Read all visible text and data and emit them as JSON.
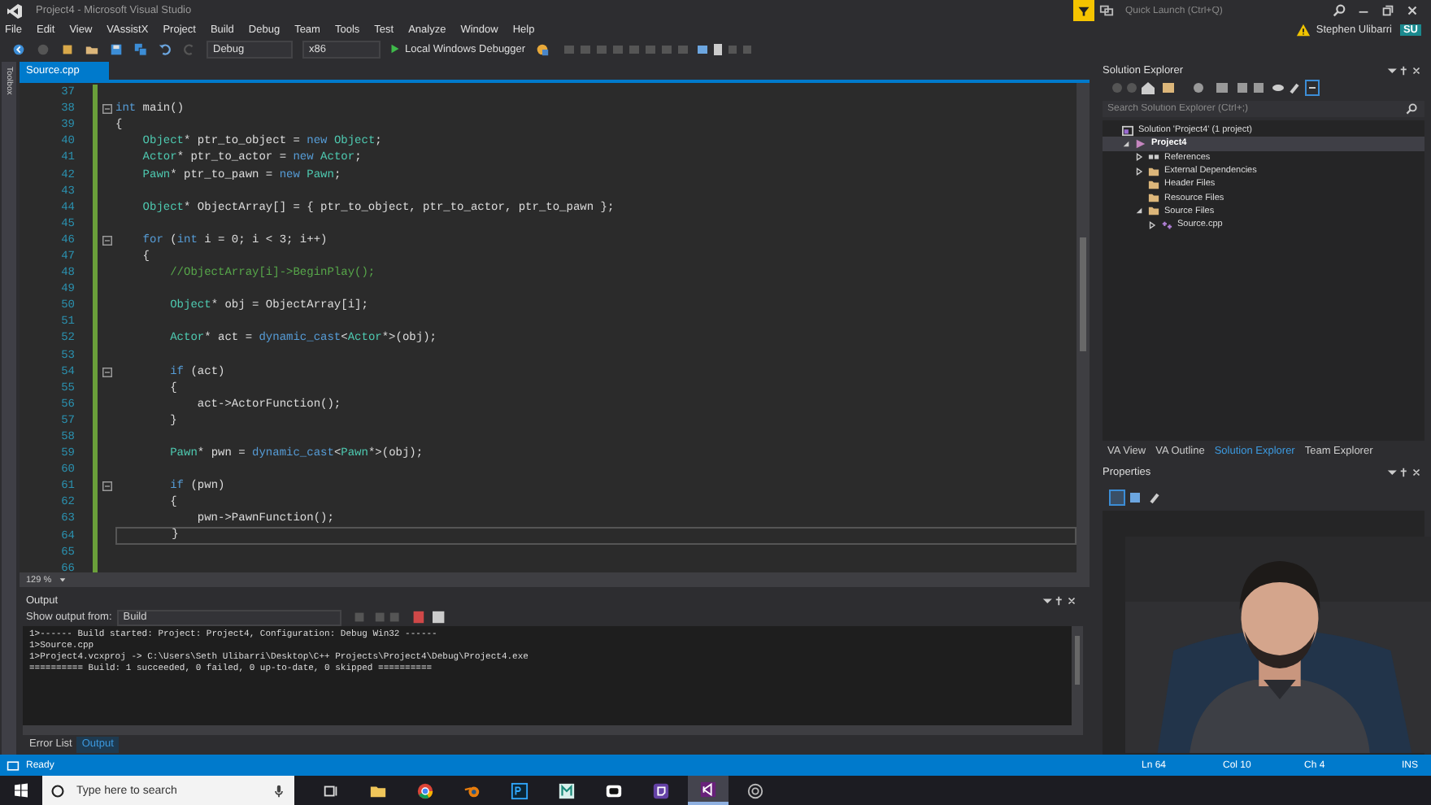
{
  "window": {
    "title": "Project4 - Microsoft Visual Studio",
    "quick_launch": {
      "placeholder": "Quick Launch (Ctrl+Q)"
    },
    "user": {
      "name": "Stephen Ulibarri",
      "initials": "SU"
    }
  },
  "menu": [
    "File",
    "Edit",
    "View",
    "VAssistX",
    "Project",
    "Build",
    "Debug",
    "Team",
    "Tools",
    "Test",
    "Analyze",
    "Window",
    "Help"
  ],
  "toolbar": {
    "configuration": "Debug",
    "platform": "x86",
    "debugger": "Local Windows Debugger"
  },
  "side_tab": "Toolbox",
  "document_tabs": [
    {
      "label": "Source.cpp",
      "selected": true
    }
  ],
  "editor": {
    "zoom": "129 %",
    "lines": [
      {
        "number": "37",
        "fold": false,
        "current": false
      },
      {
        "number": "38",
        "fold": true,
        "current": false,
        "tokens": [
          {
            "kind": "keyword",
            "text": "int"
          },
          {
            "kind": "plain",
            "text": " main()"
          }
        ]
      },
      {
        "number": "39",
        "fold": false,
        "current": false,
        "tokens": [
          {
            "kind": "plain",
            "text": "{"
          }
        ]
      },
      {
        "number": "40",
        "fold": false,
        "current": false,
        "tokens": [
          {
            "kind": "type",
            "text": "    Object"
          },
          {
            "kind": "plain",
            "text": "* ptr_to_object = "
          },
          {
            "kind": "keyword",
            "text": "new"
          },
          {
            "kind": "type",
            "text": " Object"
          },
          {
            "kind": "plain",
            "text": ";"
          }
        ]
      },
      {
        "number": "41",
        "fold": false,
        "current": false,
        "tokens": [
          {
            "kind": "type",
            "text": "    Actor"
          },
          {
            "kind": "plain",
            "text": "* ptr_to_actor = "
          },
          {
            "kind": "keyword",
            "text": "new"
          },
          {
            "kind": "type",
            "text": " Actor"
          },
          {
            "kind": "plain",
            "text": ";"
          }
        ]
      },
      {
        "number": "42",
        "fold": false,
        "current": false,
        "tokens": [
          {
            "kind": "type",
            "text": "    Pawn"
          },
          {
            "kind": "plain",
            "text": "* ptr_to_pawn = "
          },
          {
            "kind": "keyword",
            "text": "new"
          },
          {
            "kind": "type",
            "text": " Pawn"
          },
          {
            "kind": "plain",
            "text": ";"
          }
        ]
      },
      {
        "number": "43",
        "fold": false,
        "current": false
      },
      {
        "number": "44",
        "fold": false,
        "current": false,
        "tokens": [
          {
            "kind": "type",
            "text": "    Object"
          },
          {
            "kind": "plain",
            "text": "* ObjectArray[] = { ptr_to_object, ptr_to_actor, ptr_to_pawn };"
          }
        ]
      },
      {
        "number": "45",
        "fold": false,
        "current": false
      },
      {
        "number": "46",
        "fold": true,
        "current": false,
        "tokens": [
          {
            "kind": "keyword",
            "text": "    for"
          },
          {
            "kind": "plain",
            "text": " ("
          },
          {
            "kind": "keyword",
            "text": "int"
          },
          {
            "kind": "plain",
            "text": " i = 0; i < 3; i++)"
          }
        ]
      },
      {
        "number": "47",
        "fold": false,
        "current": false,
        "tokens": [
          {
            "kind": "plain",
            "text": "    {"
          }
        ]
      },
      {
        "number": "48",
        "fold": false,
        "current": false,
        "tokens": [
          {
            "kind": "comment",
            "text": "        //ObjectArray[i]->BeginPlay();"
          }
        ]
      },
      {
        "number": "49",
        "fold": false,
        "current": false
      },
      {
        "number": "50",
        "fold": false,
        "current": false,
        "tokens": [
          {
            "kind": "type",
            "text": "        Object"
          },
          {
            "kind": "plain",
            "text": "* obj = ObjectArray[i];"
          }
        ]
      },
      {
        "number": "51",
        "fold": false,
        "current": false
      },
      {
        "number": "52",
        "fold": false,
        "current": false,
        "tokens": [
          {
            "kind": "type",
            "text": "        Actor"
          },
          {
            "kind": "plain",
            "text": "* act = "
          },
          {
            "kind": "keyword",
            "text": "dynamic_cast"
          },
          {
            "kind": "plain",
            "text": "<"
          },
          {
            "kind": "type",
            "text": "Actor"
          },
          {
            "kind": "plain",
            "text": "*>(obj);"
          }
        ]
      },
      {
        "number": "53",
        "fold": false,
        "current": false
      },
      {
        "number": "54",
        "fold": true,
        "current": false,
        "tokens": [
          {
            "kind": "keyword",
            "text": "        if"
          },
          {
            "kind": "plain",
            "text": " (act)"
          }
        ]
      },
      {
        "number": "55",
        "fold": false,
        "current": false,
        "tokens": [
          {
            "kind": "plain",
            "text": "        {"
          }
        ]
      },
      {
        "number": "56",
        "fold": false,
        "current": false,
        "tokens": [
          {
            "kind": "plain",
            "text": "            act->ActorFunction();"
          }
        ]
      },
      {
        "number": "57",
        "fold": false,
        "current": false,
        "tokens": [
          {
            "kind": "plain",
            "text": "        }"
          }
        ]
      },
      {
        "number": "58",
        "fold": false,
        "current": false
      },
      {
        "number": "59",
        "fold": false,
        "current": false,
        "tokens": [
          {
            "kind": "type",
            "text": "        Pawn"
          },
          {
            "kind": "plain",
            "text": "* pwn = "
          },
          {
            "kind": "keyword",
            "text": "dynamic_cast"
          },
          {
            "kind": "plain",
            "text": "<"
          },
          {
            "kind": "type",
            "text": "Pawn"
          },
          {
            "kind": "plain",
            "text": "*>(obj);"
          }
        ]
      },
      {
        "number": "60",
        "fold": false,
        "current": false
      },
      {
        "number": "61",
        "fold": true,
        "current": false,
        "tokens": [
          {
            "kind": "keyword",
            "text": "        if"
          },
          {
            "kind": "plain",
            "text": " (pwn)"
          }
        ]
      },
      {
        "number": "62",
        "fold": false,
        "current": false,
        "tokens": [
          {
            "kind": "plain",
            "text": "        {"
          }
        ]
      },
      {
        "number": "63",
        "fold": false,
        "current": false,
        "tokens": [
          {
            "kind": "plain",
            "text": "            pwn->PawnFunction();"
          }
        ]
      },
      {
        "number": "64",
        "fold": false,
        "current": true,
        "tokens": [
          {
            "kind": "plain",
            "text": "        }"
          }
        ]
      },
      {
        "number": "65",
        "fold": false,
        "current": false
      },
      {
        "number": "66",
        "fold": false,
        "current": false
      }
    ]
  },
  "output": {
    "title": "Output",
    "source_label": "Show output from:",
    "source": "Build",
    "lines": [
      "1>------ Build started: Project: Project4, Configuration: Debug Win32 ------",
      "1>Source.cpp",
      "1>Project4.vcxproj -> C:\\Users\\Seth Ulibarri\\Desktop\\C++ Projects\\Project4\\Debug\\Project4.exe",
      "========== Build: 1 succeeded, 0 failed, 0 up-to-date, 0 skipped =========="
    ]
  },
  "bottom_tabs": [
    {
      "label": "Error List",
      "selected": false
    },
    {
      "label": "Output",
      "selected": true
    }
  ],
  "solution_explorer": {
    "title": "Solution Explorer",
    "search": {
      "placeholder": "Search Solution Explorer (Ctrl+;)"
    },
    "tree": [
      {
        "label": "Solution 'Project4' (1 project)",
        "kind": "solution",
        "selected": false,
        "children": [
          {
            "label": "Project4",
            "kind": "project",
            "expanded": true,
            "selected": true,
            "children": [
              {
                "label": "References",
                "kind": "references",
                "expanded": false,
                "selected": false
              },
              {
                "label": "External Dependencies",
                "kind": "folder",
                "expanded": false,
                "selected": false
              },
              {
                "label": "Header Files",
                "kind": "folder",
                "selected": false
              },
              {
                "label": "Resource Files",
                "kind": "folder",
                "selected": false
              },
              {
                "label": "Source Files",
                "kind": "folder",
                "expanded": true,
                "selected": false,
                "children": [
                  {
                    "label": "Source.cpp",
                    "kind": "cpp",
                    "expanded": false,
                    "selected": false
                  }
                ]
              }
            ]
          }
        ]
      }
    ],
    "tabs": [
      {
        "label": "VA View",
        "selected": false
      },
      {
        "label": "VA Outline",
        "selected": false
      },
      {
        "label": "Solution Explorer",
        "selected": true
      },
      {
        "label": "Team Explorer",
        "selected": false
      }
    ]
  },
  "properties": {
    "title": "Properties"
  },
  "status_bar": {
    "message": "Ready",
    "line": "Ln 64",
    "column": "Col 10",
    "char": "Ch 4",
    "mode": "INS"
  },
  "taskbar": {
    "search": {
      "placeholder": "Type here to search"
    }
  }
}
